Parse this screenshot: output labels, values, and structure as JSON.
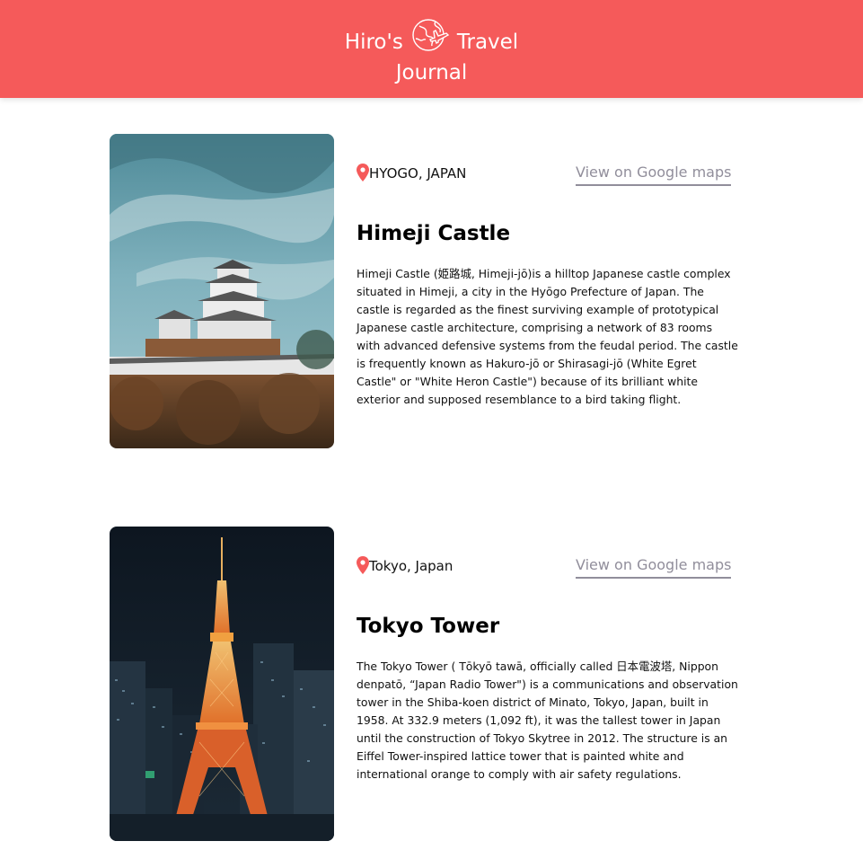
{
  "header": {
    "title_part1": "Hiro's",
    "title_part2": "Travel",
    "title_line2": "Journal",
    "logo_icon": "globe-plane-icon",
    "background_color": "#f55a5a"
  },
  "entries": [
    {
      "location": "HYOGO, JAPAN",
      "maps_link": "View on Google maps",
      "title": "Himeji Castle",
      "description": "Himeji Castle (姫路城, Himeji-jō)is a hilltop Japanese castle complex situated in Himeji, a city in the Hyōgo Prefecture of Japan. The castle is regarded as the finest surviving example of prototypical Japanese castle architecture, comprising a network of 83 rooms with advanced defensive systems from the feudal period. The castle is frequently known as Hakuro-jō or Shirasagi-jō (White Egret Castle\" or \"White Heron Castle\") because of its brilliant white exterior and supposed resemblance to a bird taking flight.",
      "image_icon": "himeji-castle-photo",
      "pin_icon": "map-pin-icon"
    },
    {
      "location": "Tokyo, Japan",
      "maps_link": "View on Google maps",
      "title": "Tokyo Tower",
      "description": "The Tokyo Tower ( Tōkyō tawā, officially called 日本電波塔, Nippon denpatō, “Japan Radio Tower\") is a communications and observation tower in the Shiba-koen district of Minato, Tokyo, Japan, built in 1958. At 332.9 meters (1,092 ft), it was the tallest tower in Japan until the construction of Tokyo Skytree in 2012. The structure is an Eiffel Tower-inspired lattice tower that is painted white and international orange to comply with air safety regulations.",
      "image_icon": "tokyo-tower-photo",
      "pin_icon": "map-pin-icon"
    }
  ],
  "colors": {
    "accent": "#f55a5a",
    "link": "#918e9b",
    "pin": "#f55a5a"
  }
}
